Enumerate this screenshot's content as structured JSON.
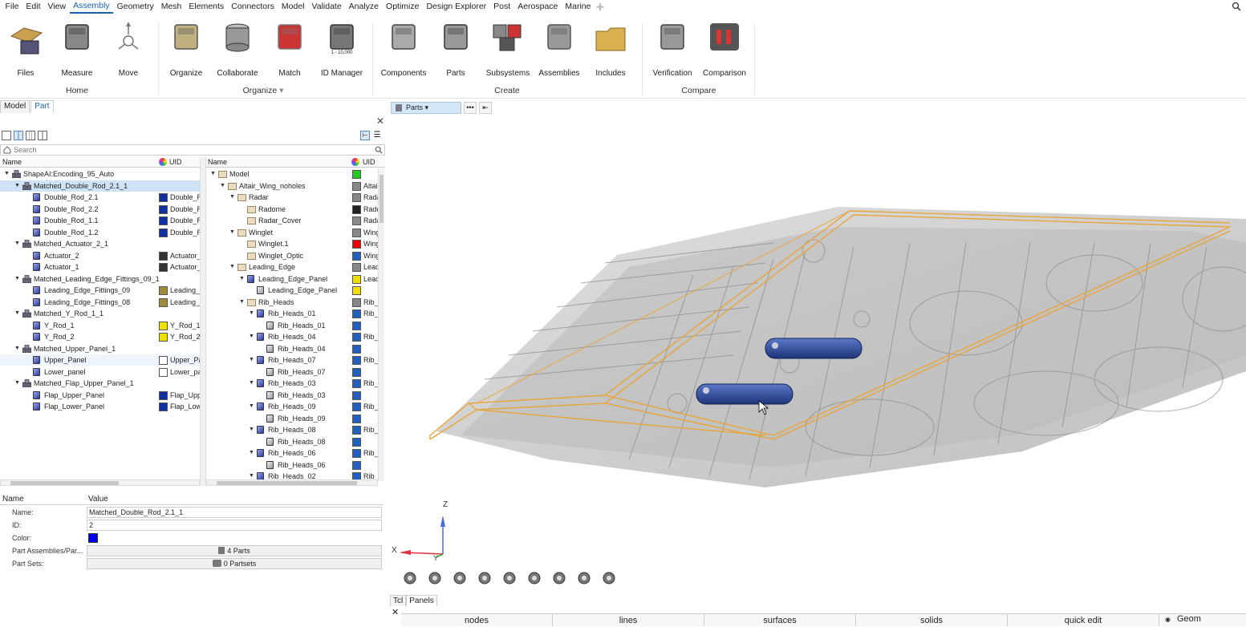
{
  "menu": [
    "File",
    "Edit",
    "View",
    "Assembly",
    "Geometry",
    "Mesh",
    "Elements",
    "Connectors",
    "Model",
    "Validate",
    "Analyze",
    "Optimize",
    "Design Explorer",
    "Post",
    "Aerospace",
    "Marine"
  ],
  "menu_active": "Assembly",
  "ribbon": {
    "tools": [
      {
        "label": "Files",
        "icon": "files-icon"
      },
      {
        "label": "Measure",
        "icon": "measure-icon"
      },
      {
        "label": "Move",
        "icon": "move-icon"
      },
      {
        "label": "Organize",
        "icon": "organize-icon"
      },
      {
        "label": "Collaborate",
        "icon": "collaborate-icon"
      },
      {
        "label": "Match",
        "icon": "match-icon"
      },
      {
        "label": "ID Manager",
        "icon": "id-manager-icon",
        "sub": "1 - 10,000"
      },
      {
        "label": "Components",
        "icon": "components-icon"
      },
      {
        "label": "Parts",
        "icon": "parts-icon"
      },
      {
        "label": "Subsystems",
        "icon": "subsystems-icon"
      },
      {
        "label": "Assemblies",
        "icon": "assemblies-icon"
      },
      {
        "label": "Includes",
        "icon": "includes-icon"
      },
      {
        "label": "Verification",
        "icon": "verification-icon"
      },
      {
        "label": "Comparison",
        "icon": "comparison-icon"
      }
    ],
    "groups": [
      "Home",
      "Organize",
      "Create",
      "Compare"
    ]
  },
  "left_tabs": [
    "Model",
    "Part"
  ],
  "left_tab_active": "Part",
  "search_placeholder": "Search",
  "tree_left": {
    "col_name": "Name",
    "col_uid": "UID",
    "rows": [
      {
        "label": "ShapeAI:Encoding_95_Auto",
        "level": 0,
        "type": "asm",
        "open": true,
        "uid": ""
      },
      {
        "label": "Matched_Double_Rod_2.1_1",
        "level": 1,
        "type": "asm",
        "open": true,
        "uid": "",
        "sel": true
      },
      {
        "label": "Double_Rod_2.1",
        "level": 2,
        "type": "part",
        "uid": "Double_R",
        "color": "#1030a0"
      },
      {
        "label": "Double_Rod_2.2",
        "level": 2,
        "type": "part",
        "uid": "Double_R",
        "color": "#1030a0"
      },
      {
        "label": "Double_Rod_1.1",
        "level": 2,
        "type": "part",
        "uid": "Double_R",
        "color": "#1030a0"
      },
      {
        "label": "Double_Rod_1.2",
        "level": 2,
        "type": "part",
        "uid": "Double_R",
        "color": "#1030a0"
      },
      {
        "label": "Matched_Actuator_2_1",
        "level": 1,
        "type": "asm",
        "open": true,
        "uid": ""
      },
      {
        "label": "Actuator_2",
        "level": 2,
        "type": "part",
        "uid": "Actuator_",
        "color": "#333333"
      },
      {
        "label": "Actuator_1",
        "level": 2,
        "type": "part",
        "uid": "Actuator_",
        "color": "#333333"
      },
      {
        "label": "Matched_Leading_Edge_Fittings_09_1",
        "level": 1,
        "type": "asm",
        "open": true,
        "uid": ""
      },
      {
        "label": "Leading_Edge_Fittings_09",
        "level": 2,
        "type": "part",
        "uid": "Leading_",
        "color": "#a08c3c"
      },
      {
        "label": "Leading_Edge_Fittings_08",
        "level": 2,
        "type": "part",
        "uid": "Leading_",
        "color": "#a08c3c"
      },
      {
        "label": "Matched_Y_Rod_1_1",
        "level": 1,
        "type": "asm",
        "open": true,
        "uid": ""
      },
      {
        "label": "Y_Rod_1",
        "level": 2,
        "type": "part",
        "uid": "Y_Rod_1",
        "color": "#f0e000"
      },
      {
        "label": "Y_Rod_2",
        "level": 2,
        "type": "part",
        "uid": "Y_Rod_2",
        "color": "#f0e000"
      },
      {
        "label": "Matched_Upper_Panel_1",
        "level": 1,
        "type": "asm",
        "open": true,
        "uid": ""
      },
      {
        "label": "Upper_Panel",
        "level": 2,
        "type": "part",
        "uid": "Upper_Pa",
        "color": "#ffffff",
        "hover": true
      },
      {
        "label": "Lower_panel",
        "level": 2,
        "type": "part",
        "uid": "Lower_pa",
        "color": "#ffffff"
      },
      {
        "label": "Matched_Flap_Upper_Panel_1",
        "level": 1,
        "type": "asm",
        "open": true,
        "uid": ""
      },
      {
        "label": "Flap_Upper_Panel",
        "level": 2,
        "type": "part",
        "uid": "Flap_Upp",
        "color": "#1030a0"
      },
      {
        "label": "Flap_Lower_Panel",
        "level": 2,
        "type": "part",
        "uid": "Flap_Low",
        "color": "#1030a0"
      }
    ]
  },
  "tree_right": {
    "col_name": "Name",
    "col_uid": "UID",
    "rows": [
      {
        "label": "Model",
        "level": 0,
        "type": "folder",
        "open": true,
        "uid": "",
        "color": "#22cc22"
      },
      {
        "label": "Altair_Wing_noholes",
        "level": 1,
        "type": "folder",
        "open": true,
        "uid": "Altair",
        "color": "#888888"
      },
      {
        "label": "Radar",
        "level": 2,
        "type": "folder",
        "open": true,
        "uid": "Rada",
        "color": "#888888"
      },
      {
        "label": "Radome",
        "level": 3,
        "type": "folder",
        "uid": "Rado",
        "color": "#222222"
      },
      {
        "label": "Radar_Cover",
        "level": 3,
        "type": "folder",
        "uid": "Rada",
        "color": "#888888"
      },
      {
        "label": "Winglet",
        "level": 2,
        "type": "folder",
        "open": true,
        "uid": "Wing",
        "color": "#888888"
      },
      {
        "label": "Winglet.1",
        "level": 3,
        "type": "folder",
        "uid": "Wing",
        "color": "#ee0000"
      },
      {
        "label": "Winglet_Optic",
        "level": 3,
        "type": "folder",
        "uid": "Wing",
        "color": "#2060c0"
      },
      {
        "label": "Leading_Edge",
        "level": 2,
        "type": "folder",
        "open": true,
        "uid": "Lead",
        "color": "#888888"
      },
      {
        "label": "Leading_Edge_Panel",
        "level": 3,
        "type": "part",
        "open": true,
        "uid": "Lead",
        "color": "#f0e000"
      },
      {
        "label": "Leading_Edge_Panel",
        "level": 4,
        "type": "comp",
        "uid": "",
        "color": "#f0e000"
      },
      {
        "label": "Rib_Heads",
        "level": 3,
        "type": "folder",
        "open": true,
        "uid": "Rib_",
        "color": "#888888"
      },
      {
        "label": "Rib_Heads_01",
        "level": 4,
        "type": "part",
        "open": true,
        "uid": "Rib_",
        "color": "#2060c0"
      },
      {
        "label": "Rib_Heads_01",
        "level": 5,
        "type": "comp",
        "uid": "",
        "color": "#2060c0"
      },
      {
        "label": "Rib_Heads_04",
        "level": 4,
        "type": "part",
        "open": true,
        "uid": "Rib_",
        "color": "#2060c0"
      },
      {
        "label": "Rib_Heads_04",
        "level": 5,
        "type": "comp",
        "uid": "",
        "color": "#2060c0"
      },
      {
        "label": "Rib_Heads_07",
        "level": 4,
        "type": "part",
        "open": true,
        "uid": "Rib_",
        "color": "#2060c0"
      },
      {
        "label": "Rib_Heads_07",
        "level": 5,
        "type": "comp",
        "uid": "",
        "color": "#2060c0"
      },
      {
        "label": "Rib_Heads_03",
        "level": 4,
        "type": "part",
        "open": true,
        "uid": "Rib_",
        "color": "#2060c0"
      },
      {
        "label": "Rib_Heads_03",
        "level": 5,
        "type": "comp",
        "uid": "",
        "color": "#2060c0"
      },
      {
        "label": "Rib_Heads_09",
        "level": 4,
        "type": "part",
        "open": true,
        "uid": "Rib_",
        "color": "#2060c0"
      },
      {
        "label": "Rib_Heads_09",
        "level": 5,
        "type": "comp",
        "uid": "",
        "color": "#2060c0"
      },
      {
        "label": "Rib_Heads_08",
        "level": 4,
        "type": "part",
        "open": true,
        "uid": "Rib_",
        "color": "#2060c0"
      },
      {
        "label": "Rib_Heads_08",
        "level": 5,
        "type": "comp",
        "uid": "",
        "color": "#2060c0"
      },
      {
        "label": "Rib_Heads_06",
        "level": 4,
        "type": "part",
        "open": true,
        "uid": "Rib_",
        "color": "#2060c0"
      },
      {
        "label": "Rib_Heads_06",
        "level": 5,
        "type": "comp",
        "uid": "",
        "color": "#2060c0"
      },
      {
        "label": "Rib_Heads_02",
        "level": 4,
        "type": "part",
        "open": true,
        "uid": "Rib_",
        "color": "#2060c0"
      }
    ]
  },
  "props": {
    "col_name": "Name",
    "col_value": "Value",
    "name_label": "Name:",
    "name_value": "Matched_Double_Rod_2.1_1",
    "id_label": "ID:",
    "id_value": "2",
    "color_label": "Color:",
    "color_value": "#0000ee",
    "pa_label": "Part Assemblies/Par...",
    "pa_value": "4 Parts",
    "ps_label": "Part Sets:",
    "ps_value": "0 Partsets"
  },
  "viewport": {
    "parts_dropdown": "Parts",
    "more": "•••",
    "axis_x": "X",
    "axis_y": "Y",
    "axis_z": "Z"
  },
  "bottom_tabs": [
    "Tcl",
    "Panels"
  ],
  "bottom_tab_active": "Panels",
  "panel_bar": [
    "nodes",
    "lines",
    "surfaces",
    "solids",
    "quick edit"
  ],
  "geom_label": "Geom",
  "colors": {
    "accent": "#1a5fb4",
    "wire": "#e8a53a",
    "rod": "#2a4aa0"
  }
}
